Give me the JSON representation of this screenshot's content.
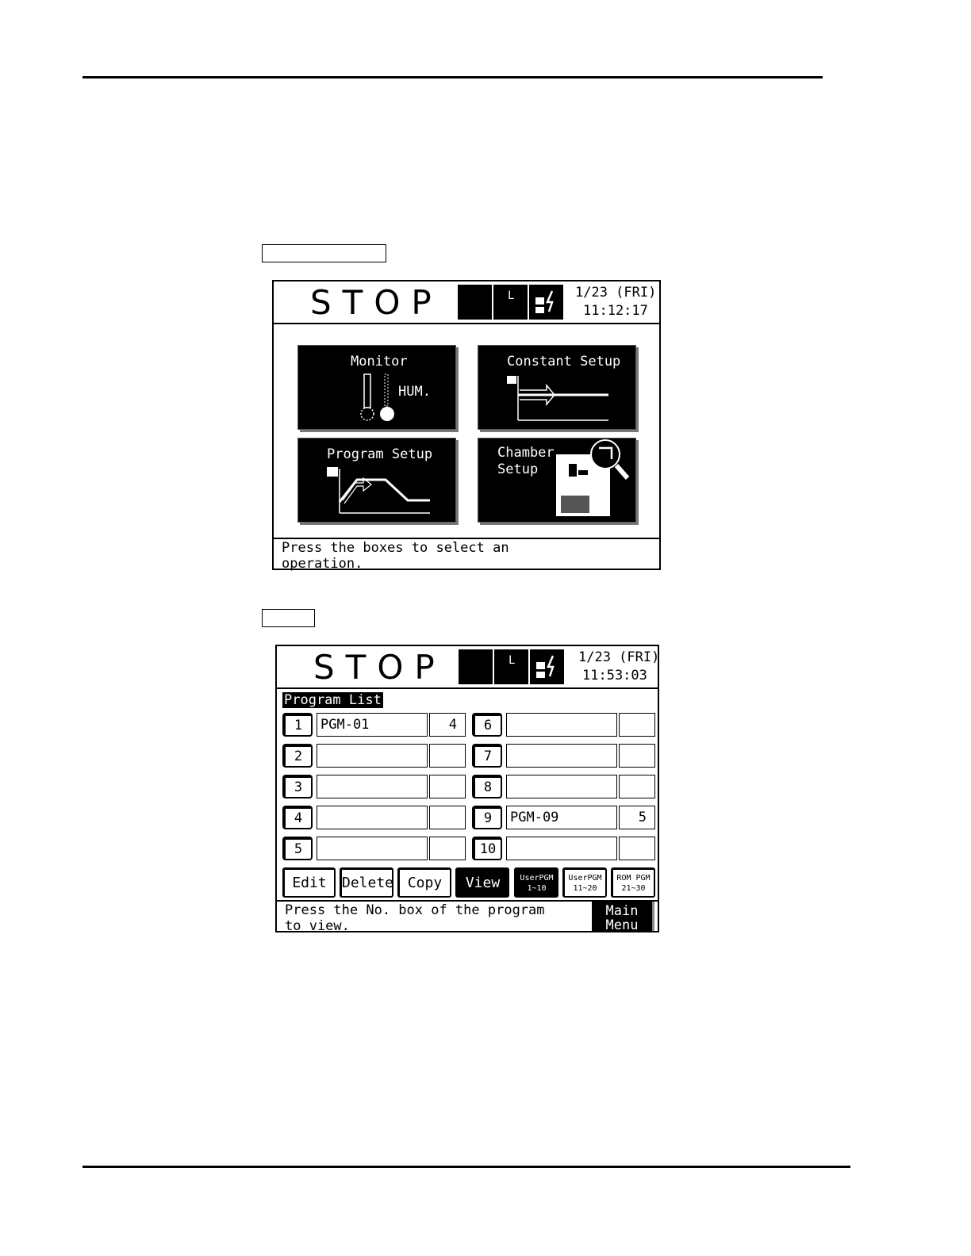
{
  "screen1": {
    "status": "STOP",
    "date": "1/23 (FRI)",
    "time": "11:12:17",
    "indicator_letter": "L",
    "tiles": {
      "monitor": {
        "title": "Monitor",
        "sub": "HUM."
      },
      "constant": {
        "title": "Constant Setup"
      },
      "program": {
        "title": "Program Setup"
      },
      "chamber": {
        "title": "Chamber\nSetup"
      }
    },
    "message": "Press the boxes to select an\noperation."
  },
  "screen2": {
    "status": "STOP",
    "date": "1/23 (FRI)",
    "time": "11:53:03",
    "indicator_letter": "L",
    "list_title": "Program List",
    "programs": [
      {
        "no": "1",
        "name": "PGM-01",
        "count": "4"
      },
      {
        "no": "2",
        "name": "",
        "count": ""
      },
      {
        "no": "3",
        "name": "",
        "count": ""
      },
      {
        "no": "4",
        "name": "",
        "count": ""
      },
      {
        "no": "5",
        "name": "",
        "count": ""
      },
      {
        "no": "6",
        "name": "",
        "count": ""
      },
      {
        "no": "7",
        "name": "",
        "count": ""
      },
      {
        "no": "8",
        "name": "",
        "count": ""
      },
      {
        "no": "9",
        "name": "PGM-09",
        "count": "5"
      },
      {
        "no": "10",
        "name": "",
        "count": ""
      }
    ],
    "buttons": {
      "edit": "Edit",
      "delete": "Delete",
      "copy": "Copy",
      "view": "View"
    },
    "pages": {
      "p1": {
        "line1": "UserPGM",
        "line2": "1~10"
      },
      "p2": {
        "line1": "UserPGM",
        "line2": "11~20"
      },
      "p3": {
        "line1": "ROM PGM",
        "line2": "21~30"
      }
    },
    "message": "Press the No. box of the program\nto view.",
    "main_menu": "Main\nMenu"
  }
}
